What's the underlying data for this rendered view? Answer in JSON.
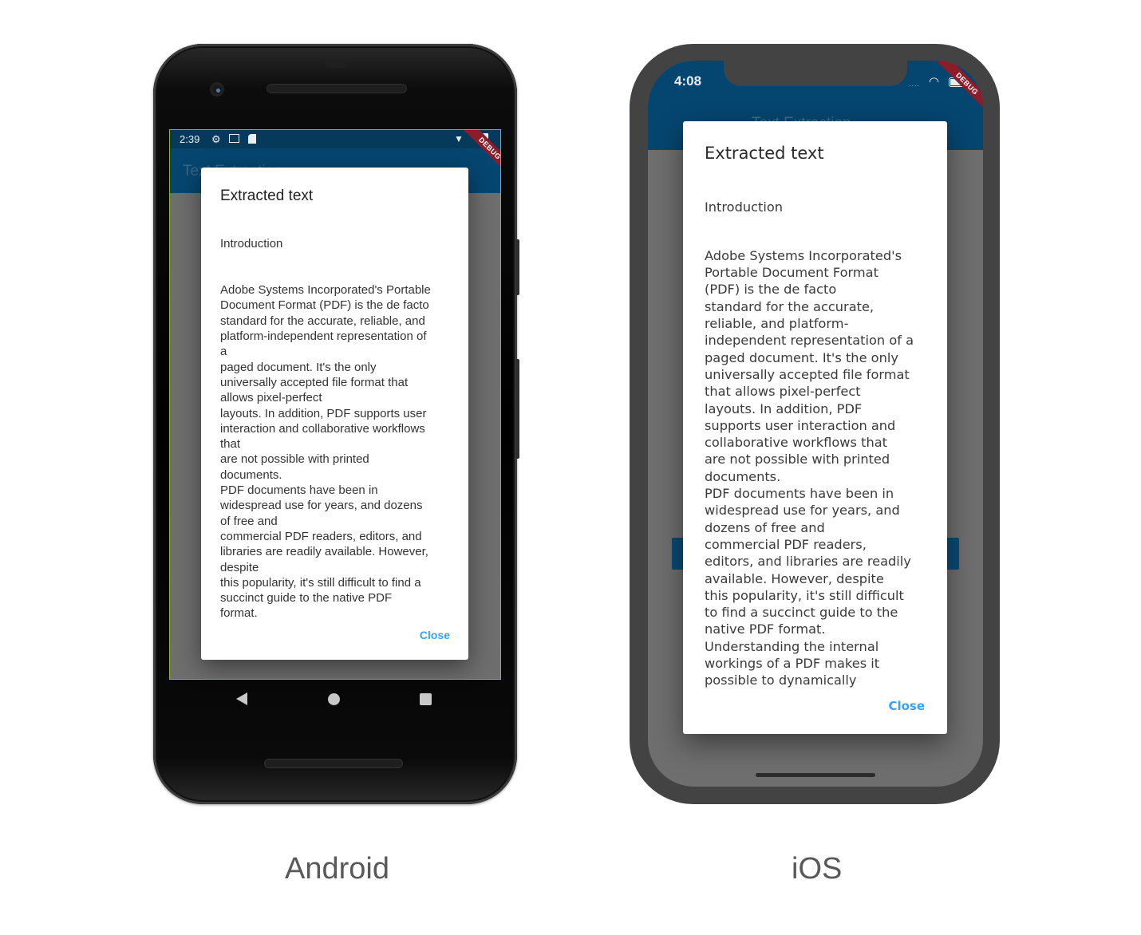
{
  "captions": {
    "android": "Android",
    "ios": "iOS"
  },
  "android": {
    "status_bar": {
      "time": "2:39",
      "icons": [
        "settings-icon",
        "photo-icon",
        "sd-card-icon",
        "wifi-icon",
        "signal-icon",
        "battery-icon"
      ]
    },
    "debug_banner": "DEBUG",
    "app_bar_title": "Text Extraction",
    "dialog": {
      "title": "Extracted text",
      "heading": "Introduction",
      "body": "Adobe Systems Incorporated's Portable\nDocument Format (PDF) is the de facto\nstandard for the accurate, reliable, and\nplatform-independent representation of\na\npaged document. It's the only\nuniversally accepted file format that\nallows pixel-perfect\nlayouts. In addition, PDF supports user\ninteraction and collaborative workflows\nthat\nare not possible with printed\ndocuments.\nPDF documents have been in\nwidespread use for years, and dozens\nof free and\ncommercial PDF readers, editors, and\nlibraries are readily available. However,\ndespite\nthis popularity, it's still difficult to find a\nsuccinct guide to the native PDF\nformat.",
      "close_label": "Close"
    },
    "nav_bar": [
      "back-icon",
      "home-icon",
      "recents-icon"
    ]
  },
  "ios": {
    "status_bar": {
      "time": "4:08",
      "signal": "....",
      "icons": [
        "wifi-icon",
        "battery-icon"
      ]
    },
    "debug_banner": "DEBUG",
    "app_bar_title": "Text Extraction",
    "dialog": {
      "title": "Extracted text",
      "heading": "Introduction",
      "body": "Adobe Systems Incorporated's\nPortable Document Format\n(PDF) is the de facto\nstandard for the accurate,\nreliable, and platform-\nindependent representation of a\npaged document. It's the only\nuniversally accepted file format\nthat allows pixel-perfect\nlayouts. In addition, PDF\nsupports user interaction and\ncollaborative workflows that\nare not possible with printed\ndocuments.\nPDF documents have been in\nwidespread use for years, and\ndozens of free and\ncommercial PDF readers,\neditors, and libraries are readily\navailable. However, despite\nthis popularity, it's still difficult\nto find a succinct guide to the\nnative PDF format.\nUnderstanding the internal\nworkings of a PDF makes it\npossible to dynamically",
      "close_label": "Close"
    }
  },
  "colors": {
    "app_bar": "#054670",
    "status_bar": "#063a5a",
    "accent": "#3aa0f0",
    "debug_banner": "#8b1c2a",
    "scrim": "#6e6e6e"
  }
}
